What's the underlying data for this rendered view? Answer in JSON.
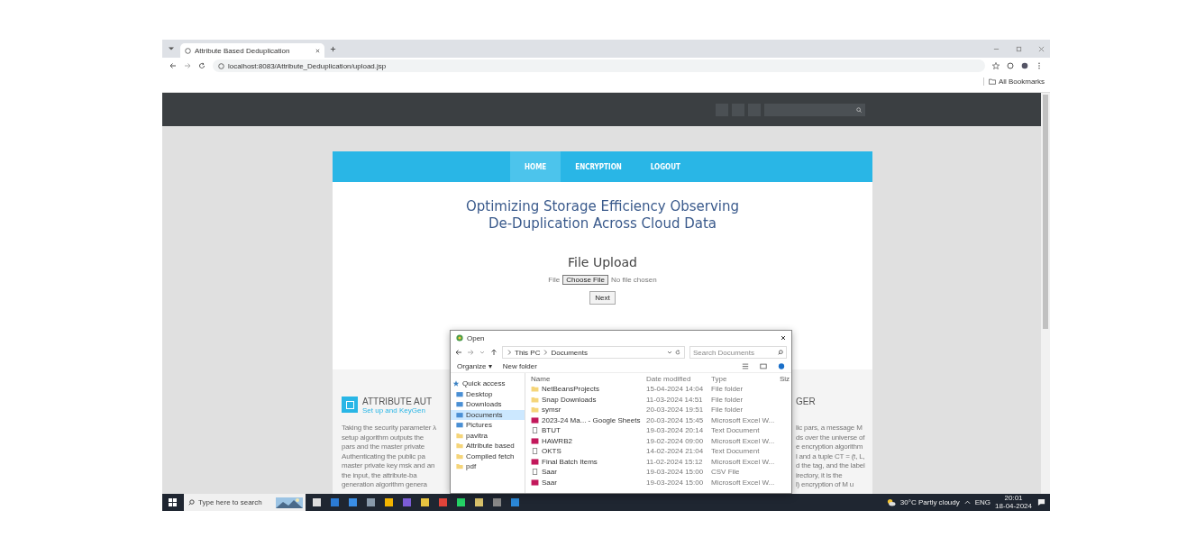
{
  "browser": {
    "tab_title": "Attribute Based Deduplication",
    "url": "localhost:8083/Attribute_Deduplication/upload.jsp",
    "bookmarks_label": "All Bookmarks"
  },
  "nav": [
    {
      "label": "HOME",
      "selected": true
    },
    {
      "label": "ENCRYPTION",
      "selected": false
    },
    {
      "label": "LOGOUT",
      "selected": false
    }
  ],
  "page": {
    "title_lines": [
      "Optimizing Storage Efficiency Observing",
      "De-Duplication Across Cloud Data"
    ],
    "upload_heading": "File Upload",
    "file_label": "File",
    "choose_button": "Choose File",
    "no_file_text": "No file chosen",
    "next_button": "Next"
  },
  "sections": {
    "left_heading": "ATTRIBUTE AUT",
    "left_subheading": "Set up and KeyGen",
    "left_lines": [
      "Taking the security parameter λ",
      "setup algorithm outputs the",
      "pars and the master private",
      "Authenticating the public pa",
      "master private key msk and an",
      "the input, the attribute-ba",
      "generation algorithm genera"
    ],
    "right_heading": "GER",
    "right_lines": [
      "lic pars, a message M",
      "ds over the universe of",
      "e encryption algorithm",
      "l and a tuple CT = (t, L,",
      "d the tag, and the label",
      "irectory, it is the",
      "l) encryption of M u"
    ]
  },
  "dialog": {
    "title": "Open",
    "path": [
      "This PC",
      "Documents"
    ],
    "search_placeholder": "Search Documents",
    "organize": "Organize ▾",
    "new_folder": "New folder",
    "sidebar": [
      {
        "label": "Quick access",
        "kind": "header",
        "selected": false
      },
      {
        "label": "Desktop",
        "kind": "item",
        "selected": false
      },
      {
        "label": "Downloads",
        "kind": "item",
        "selected": false
      },
      {
        "label": "Documents",
        "kind": "item",
        "selected": true
      },
      {
        "label": "Pictures",
        "kind": "item",
        "selected": false
      },
      {
        "label": "pavitra",
        "kind": "folder",
        "selected": false
      },
      {
        "label": "Attribute based",
        "kind": "folder",
        "selected": false
      },
      {
        "label": "Compiled fetch",
        "kind": "folder",
        "selected": false
      },
      {
        "label": "pdf",
        "kind": "folder",
        "selected": false
      }
    ],
    "columns": [
      "Name",
      "Date modified",
      "Type",
      "Siz"
    ],
    "files": [
      {
        "name": "NetBeansProjects",
        "date": "15-04-2024 14:04",
        "type": "File folder",
        "kind": "folder"
      },
      {
        "name": "Snap Downloads",
        "date": "11-03-2024 14:51",
        "type": "File folder",
        "kind": "folder"
      },
      {
        "name": "symsr",
        "date": "20-03-2024 19:51",
        "type": "File folder",
        "kind": "folder"
      },
      {
        "name": "2023-24 Ma... - Google Sheets",
        "date": "20-03-2024 15:45",
        "type": "Microsoft Excel W...",
        "kind": "excel"
      },
      {
        "name": "BTUT",
        "date": "19-03-2024 20:14",
        "type": "Text Document",
        "kind": "text"
      },
      {
        "name": "HAWRB2",
        "date": "19-02-2024 09:00",
        "type": "Microsoft Excel W...",
        "kind": "excel"
      },
      {
        "name": "OKTS",
        "date": "14-02-2024 21:04",
        "type": "Text Document",
        "kind": "text"
      },
      {
        "name": "Final Batch Items",
        "date": "11-02-2024 15:12",
        "type": "Microsoft Excel W...",
        "kind": "excel"
      },
      {
        "name": "Saar",
        "date": "19-03-2024 15:00",
        "type": "CSV File",
        "kind": "text"
      },
      {
        "name": "Saar",
        "date": "19-03-2024 15:00",
        "type": "Microsoft Excel W...",
        "kind": "excel"
      }
    ]
  },
  "taskbar": {
    "search_placeholder": "Type here to search",
    "weather": "30°C Partly cloudy",
    "language": "ENG",
    "time": "20:01",
    "date": "18-04-2024"
  }
}
